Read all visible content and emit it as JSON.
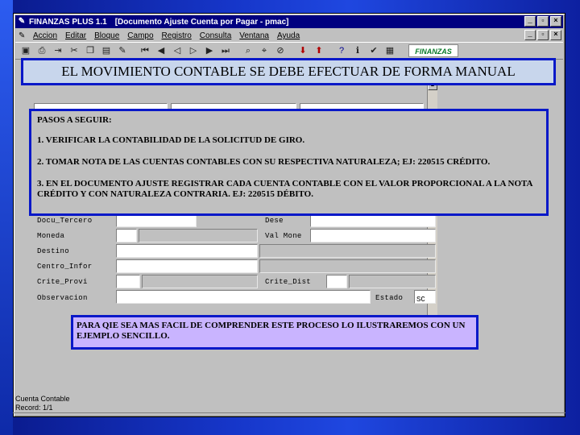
{
  "window": {
    "app_title": "FINANZAS PLUS 1.1",
    "doc_title": "[Documento Ajuste Cuenta por Pagar - pmac]",
    "controls": [
      "_",
      "▫",
      "×"
    ]
  },
  "menu": {
    "items": [
      "Accion",
      "Editar",
      "Bloque",
      "Campo",
      "Registro",
      "Consulta",
      "Ventana",
      "Ayuda"
    ],
    "controls": [
      "_",
      "▫",
      "×"
    ]
  },
  "toolbar": {
    "brand": "FINANZAS"
  },
  "form": {
    "labels": {
      "docu_tercero": "Docu_Tercero",
      "moneda": "Moneda",
      "destino": "Destino",
      "centro_infor": "Centro_Infor",
      "crite_provi": "Crite_Provi",
      "observacion": "Observacion",
      "dese": "Dese",
      "val_mone": "Val Mone",
      "crite_dist": "Crite_Dist",
      "estado": "Estado"
    },
    "estado_value": "SC"
  },
  "status": {
    "line1": "Cuenta Contable",
    "line2": "Record: 1/1"
  },
  "banner": {
    "text": "EL MOVIMIENTO CONTABLE SE DEBE EFECTUAR DE FORMA MANUAL"
  },
  "steps": {
    "heading": "PASOS A SEGUIR:",
    "step1": "1. VERIFICAR LA CONTABILIDAD DE LA SOLICITUD DE GIRO.",
    "step2": "2. TOMAR NOTA DE LAS CUENTAS CONTABLES CON SU RESPECTIVA NATURALEZA; EJ: 220515 CRÉDITO.",
    "step3": "3. EN EL DOCUMENTO AJUSTE REGISTRAR CADA CUENTA CONTABLE CON EL VALOR PROPORCIONAL A LA NOTA CRÉDITO Y CON NATURALEZA CONTRARIA. EJ: 220515 DÉBITO."
  },
  "note": {
    "text": "PARA QIE SEA MAS FACIL DE COMPRENDER ESTE PROCESO LO ILUSTRAREMOS CON UN EJEMPLO SENCILLO."
  }
}
